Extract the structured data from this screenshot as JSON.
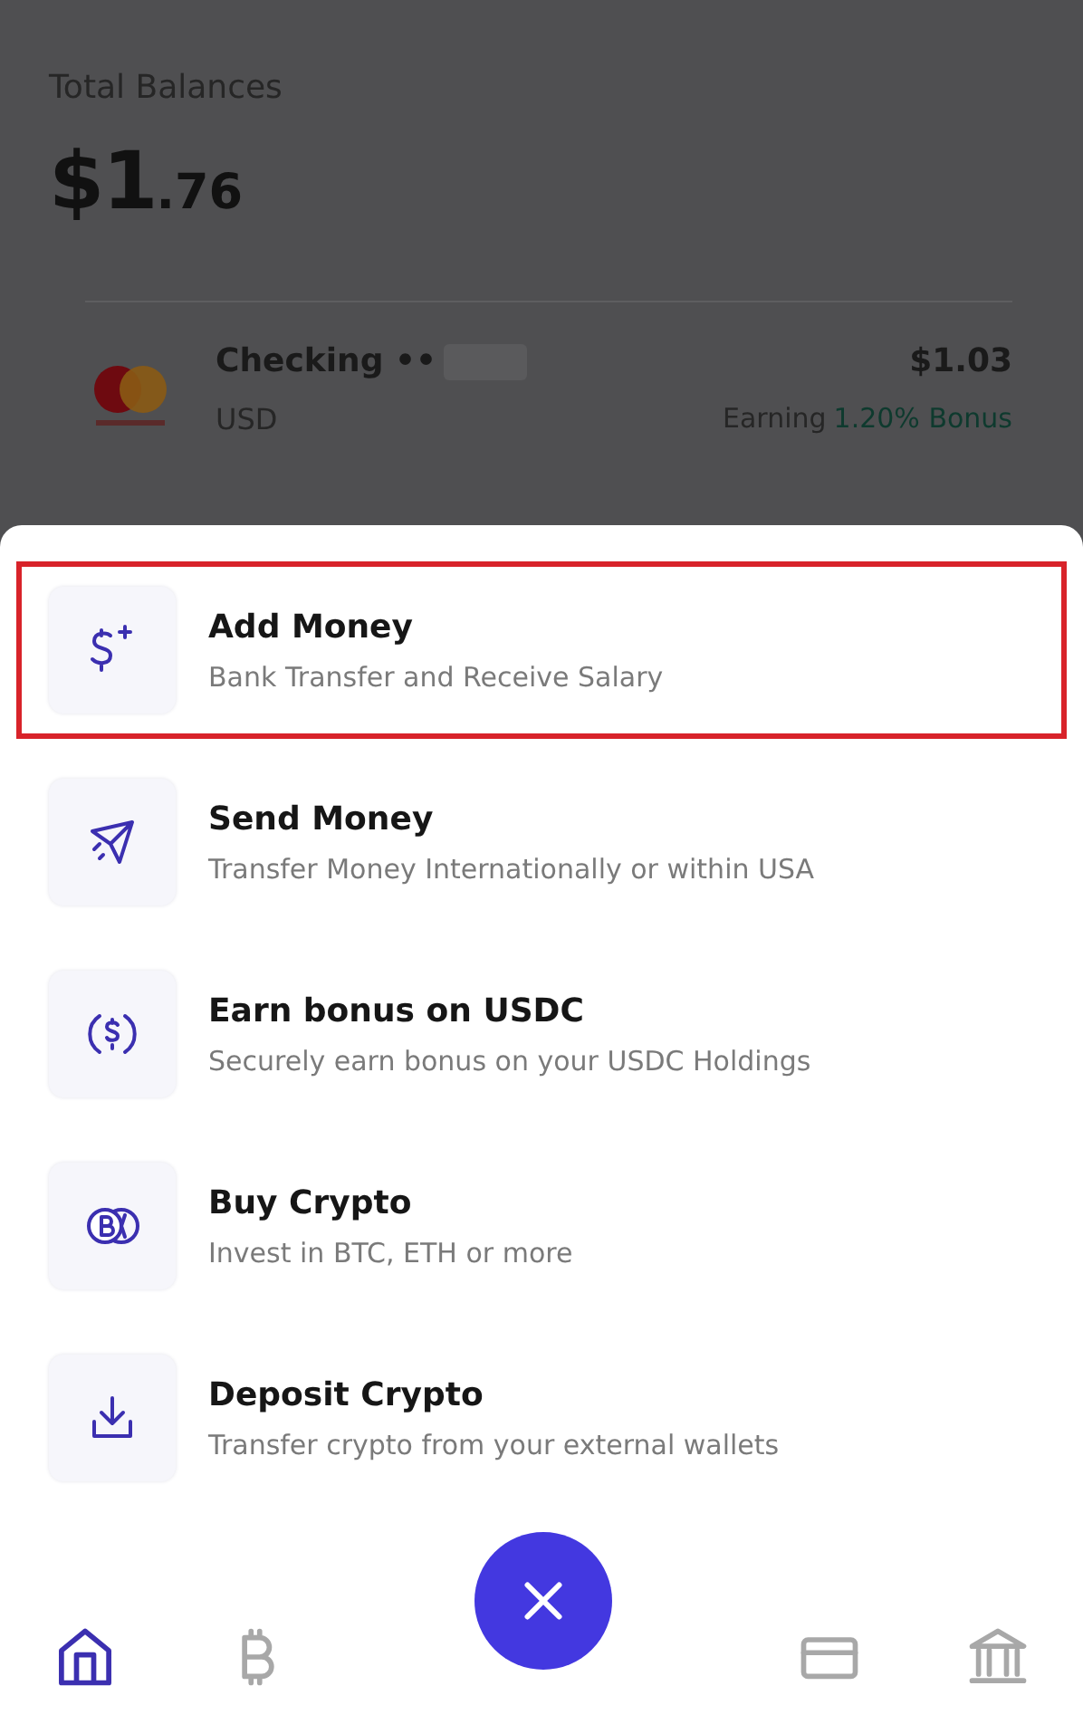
{
  "backdrop": {
    "title": "Total Balances",
    "balance_whole": "$1",
    "balance_fraction": ".76",
    "account": {
      "name": "Checking ••",
      "currency": "USD",
      "amount": "$1.03",
      "earning_label": "Earning",
      "earning_rate": "1.20% Bonus"
    }
  },
  "actions": [
    {
      "kind": "add",
      "title": "Add Money",
      "subtitle": "Bank Transfer and Receive Salary",
      "highlighted": true
    },
    {
      "kind": "send",
      "title": "Send Money",
      "subtitle": "Transfer Money Internationally or within USA",
      "highlighted": false
    },
    {
      "kind": "earn",
      "title": "Earn bonus on USDC",
      "subtitle": "Securely earn bonus on your USDC Holdings",
      "highlighted": false
    },
    {
      "kind": "buy",
      "title": "Buy Crypto",
      "subtitle": "Invest in BTC, ETH or more",
      "highlighted": false
    },
    {
      "kind": "deposit",
      "title": "Deposit Crypto",
      "subtitle": "Transfer crypto from your external wallets",
      "highlighted": false
    }
  ],
  "nav": [
    {
      "kind": "home",
      "selected": true
    },
    {
      "kind": "bitcoin",
      "selected": false
    },
    {
      "kind": "card",
      "selected": false
    },
    {
      "kind": "bank",
      "selected": false
    }
  ]
}
